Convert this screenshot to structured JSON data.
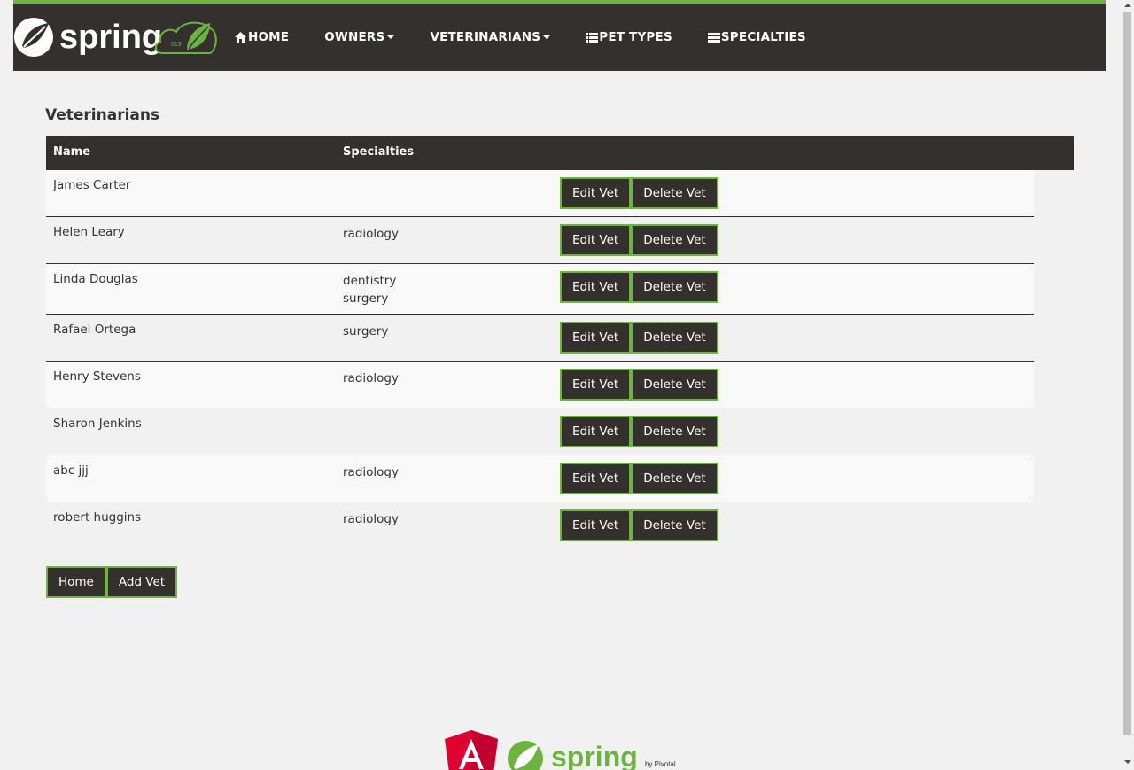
{
  "nav": {
    "brand_alt": "spring",
    "items": [
      {
        "label": "HOME",
        "icon": "home-icon"
      },
      {
        "label": "OWNERS",
        "dropdown": true
      },
      {
        "label": "VETERINARIANS",
        "dropdown": true
      },
      {
        "label": "PET TYPES",
        "icon": "list-icon"
      },
      {
        "label": "SPECIALTIES",
        "icon": "list-icon"
      }
    ]
  },
  "page": {
    "title": "Veterinarians"
  },
  "table": {
    "headers": {
      "name": "Name",
      "specialties": "Specialties"
    },
    "rows": [
      {
        "name": "James Carter",
        "specialties": []
      },
      {
        "name": "Helen Leary",
        "specialties": [
          "radiology"
        ]
      },
      {
        "name": "Linda Douglas",
        "specialties": [
          "dentistry",
          "surgery"
        ]
      },
      {
        "name": "Rafael Ortega",
        "specialties": [
          "surgery"
        ]
      },
      {
        "name": "Henry Stevens",
        "specialties": [
          "radiology"
        ]
      },
      {
        "name": "Sharon Jenkins",
        "specialties": []
      },
      {
        "name": "abc jjj",
        "specialties": [
          "radiology"
        ]
      },
      {
        "name": "robert huggins",
        "specialties": [
          "radiology"
        ]
      }
    ],
    "edit_label": "Edit Vet",
    "delete_label": "Delete Vet"
  },
  "buttons": {
    "home": "Home",
    "add": "Add Vet"
  },
  "footer": {
    "spring_text": "spring",
    "pivotal_text": "by Pivotal."
  },
  "colors": {
    "accent": "#6db33f",
    "dark": "#34302d",
    "angular_red": "#dd0031"
  }
}
